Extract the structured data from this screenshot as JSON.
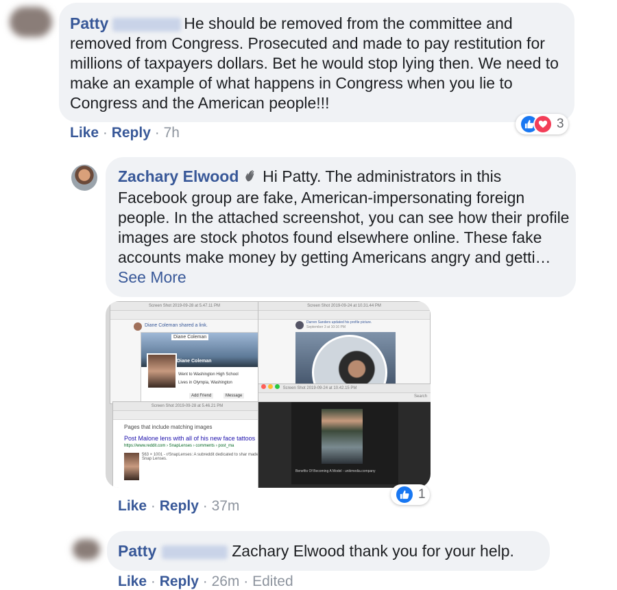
{
  "comments": [
    {
      "author": "Patty",
      "text_first_line": "He should be removed from the committee and",
      "text_rest": "removed from Congress. Prosecuted and made to pay restitution for millions of taxpayers dollars. Bet he would stop lying then. We need to make an example of what happens in Congress when you lie to Congress and the American people!!!",
      "like_label": "Like",
      "reply_label": "Reply",
      "time": "7h",
      "reaction_count": "3"
    },
    {
      "author": "Zachary Elwood",
      "text": "Hi Patty. The administrators in this Facebook group are fake, American-impersonating foreign people. In the attached screenshot, you can see how their profile images are stock photos found elsewhere online. These fake accounts make money by getting Americans angry and getti…",
      "see_more": "See More",
      "like_label": "Like",
      "reply_label": "Reply",
      "time": "37m",
      "reaction_count": "1",
      "attachment": {
        "win1_title": "Screen Shot 2019-09-28 at 5.47.11 PM",
        "win1_post": "Diane Coleman shared a link.",
        "win1_name": "Diane Coleman",
        "win1_card_name": "Diane Coleman",
        "win1_school": "Went to Washington High School",
        "win1_lives": "Lives in Olympia, Washington",
        "win1_add": "Add Friend",
        "win1_msg": "Message",
        "win2_title": "Screen Shot 2019-09-24 at 10.31.44 PM",
        "win2_post": "Darren Sanders updated his profile picture.",
        "win2_date": "September 3 at 10:16 PM",
        "win3_title": "Screen Shot 2019-09-28 at 5.46.21 PM",
        "win3_heading": "Pages that include matching images",
        "win3_link": "Post Malone lens with all of his new face tattoos",
        "win3_url": "https://www.reddit.com › SnapLenses › comments › post_ma",
        "win3_desc": "563 × 1001 - r/SnapLenses: A subreddit dedicated to shar made Snap Lenses.",
        "win4_title": "Screen Shot 2019-09-24 at 10.42.15 PM",
        "win4_caption": "Benefits Of Becoming A Model - unikmedia.company",
        "win4_search": "Search"
      }
    },
    {
      "author": "Patty",
      "text": "Zachary Elwood thank you for your help.",
      "like_label": "Like",
      "reply_label": "Reply",
      "time": "26m",
      "edited": "Edited"
    }
  ],
  "colors": {
    "link": "#385898",
    "bubble": "#f0f2f5",
    "like_blue": "#1877f2",
    "love_red": "#f33e58"
  },
  "icons": [
    "wave-icon",
    "like-reaction-icon",
    "love-reaction-icon"
  ]
}
